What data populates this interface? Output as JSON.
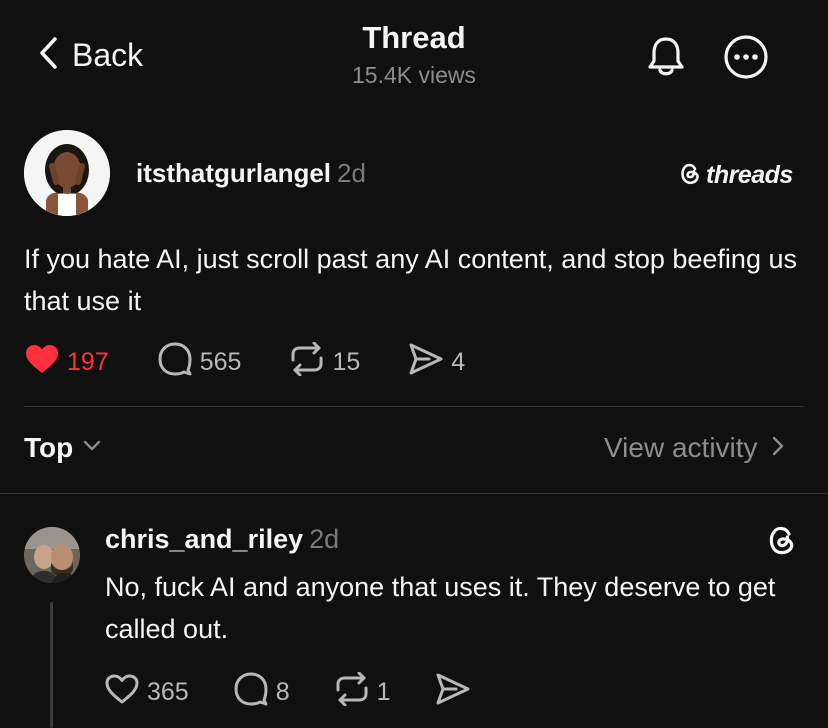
{
  "header": {
    "back_label": "Back",
    "title": "Thread",
    "views": "15.4K views"
  },
  "post": {
    "username": "itsthatgurlangel",
    "time": "2d",
    "brand": "threads",
    "text": "If you hate AI, just scroll past any AI content, and stop beefing us that use it",
    "likes": "197",
    "replies": "565",
    "reposts": "15",
    "shares": "4",
    "liked": true,
    "like_color": "#ff3040"
  },
  "sort": {
    "label": "Top",
    "activity_label": "View activity"
  },
  "reply": {
    "username": "chris_and_riley",
    "time": "2d",
    "text": "No, fuck AI and anyone that uses it. They deserve to get called out.",
    "likes": "365",
    "replies": "8",
    "reposts": "1"
  },
  "colors": {
    "background": "#101010",
    "text": "#f3f5f7",
    "muted": "#8d8d8d"
  }
}
